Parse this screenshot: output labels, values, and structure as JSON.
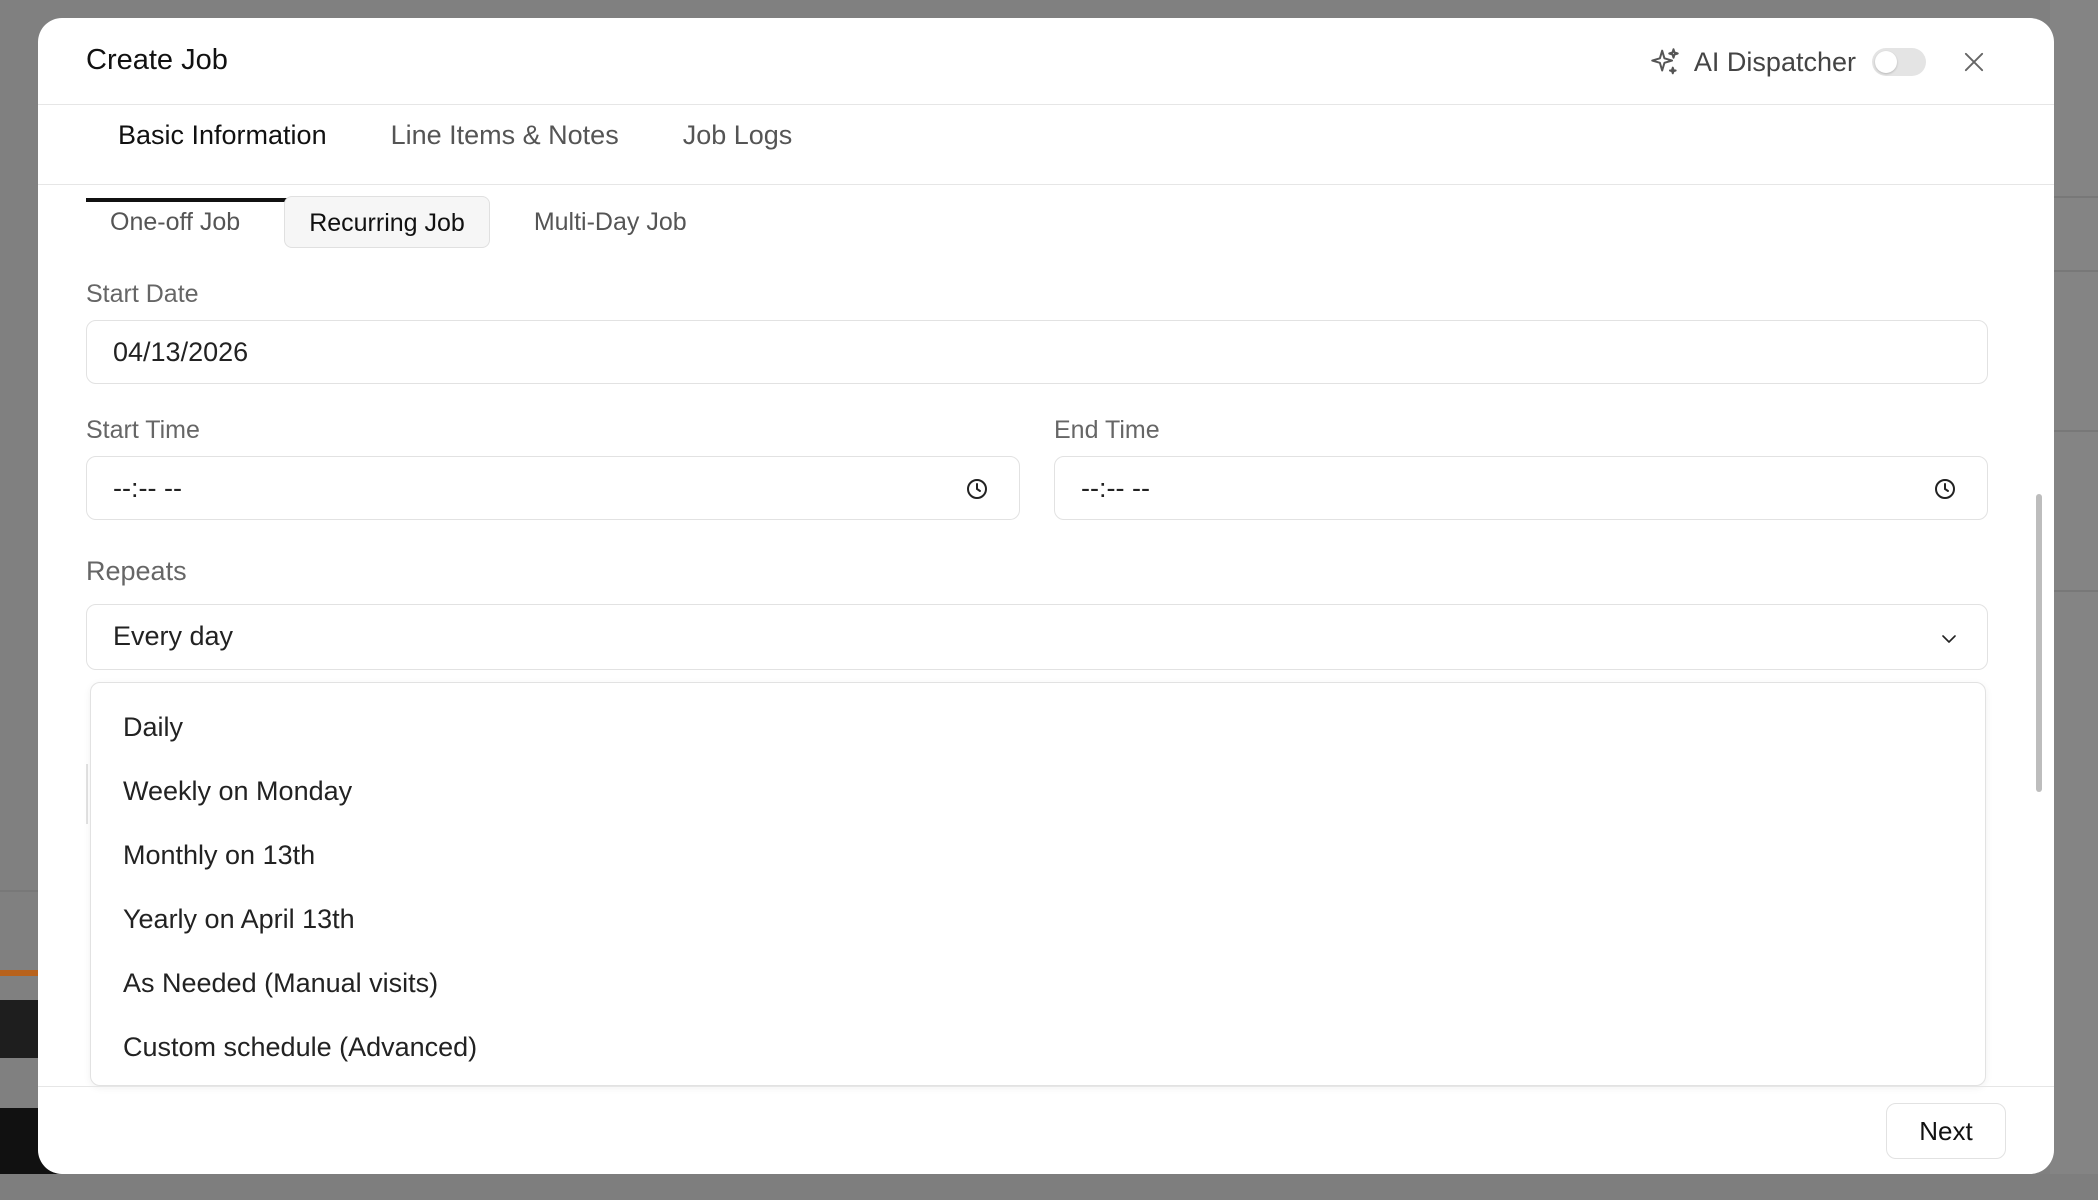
{
  "modal": {
    "title": "Create Job",
    "ai_dispatcher_label": "AI Dispatcher",
    "ai_dispatcher_enabled": false
  },
  "tabs": [
    {
      "label": "Basic Information",
      "active": true
    },
    {
      "label": "Line Items & Notes",
      "active": false
    },
    {
      "label": "Job Logs",
      "active": false
    }
  ],
  "job_types": [
    {
      "label": "One-off Job",
      "active": false
    },
    {
      "label": "Recurring Job",
      "active": true
    },
    {
      "label": "Multi-Day Job",
      "active": false
    }
  ],
  "form": {
    "start_date": {
      "label": "Start Date",
      "value": "04/13/2026"
    },
    "start_time": {
      "label": "Start Time",
      "value": "--:-- --"
    },
    "end_time": {
      "label": "End Time",
      "value": "--:-- --"
    },
    "repeats": {
      "label": "Repeats",
      "value": "Every day"
    }
  },
  "repeat_options": [
    "Daily",
    "Weekly on Monday",
    "Monthly on 13th",
    "Yearly on April 13th",
    "As Needed (Manual visits)",
    "Custom schedule (Advanced)"
  ],
  "footer": {
    "next_label": "Next"
  },
  "icons": {
    "ai": "sparkle-icon",
    "close": "close-icon",
    "time": "clock-icon",
    "select": "chevron-down-icon"
  }
}
